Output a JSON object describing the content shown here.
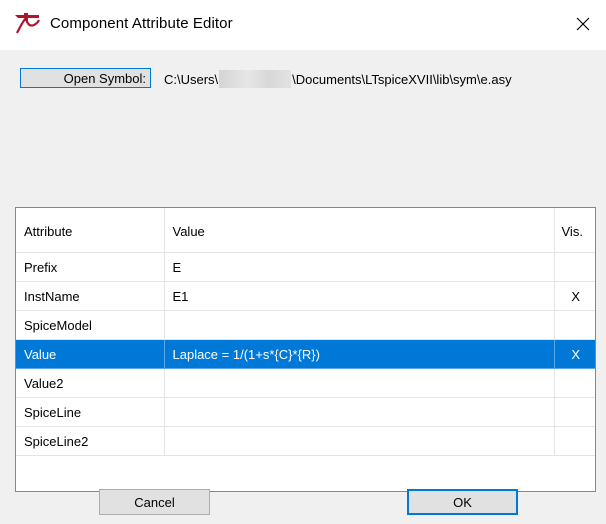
{
  "window": {
    "title": "Component Attribute Editor",
    "close_glyph": "✕"
  },
  "symbol": {
    "open_button_label": "Open Symbol:",
    "path_prefix": "C:\\Users\\",
    "path_suffix": "\\Documents\\LTspiceXVII\\lib\\sym\\e.asy"
  },
  "grid": {
    "headers": {
      "attribute": "Attribute",
      "value": "Value",
      "vis": "Vis."
    },
    "rows": [
      {
        "attribute": "Prefix",
        "value": "E",
        "vis": ""
      },
      {
        "attribute": "InstName",
        "value": "E1",
        "vis": "X"
      },
      {
        "attribute": "SpiceModel",
        "value": "",
        "vis": ""
      },
      {
        "attribute": "Value",
        "value": "Laplace = 1/(1+s*{C}*{R})",
        "vis": "X"
      },
      {
        "attribute": "Value2",
        "value": "",
        "vis": ""
      },
      {
        "attribute": "SpiceLine",
        "value": "",
        "vis": ""
      },
      {
        "attribute": "SpiceLine2",
        "value": "",
        "vis": ""
      }
    ]
  },
  "buttons": {
    "cancel": "Cancel",
    "ok": "OK"
  },
  "colors": {
    "selection": "#0078d7",
    "app_icon": "#b0152a"
  }
}
